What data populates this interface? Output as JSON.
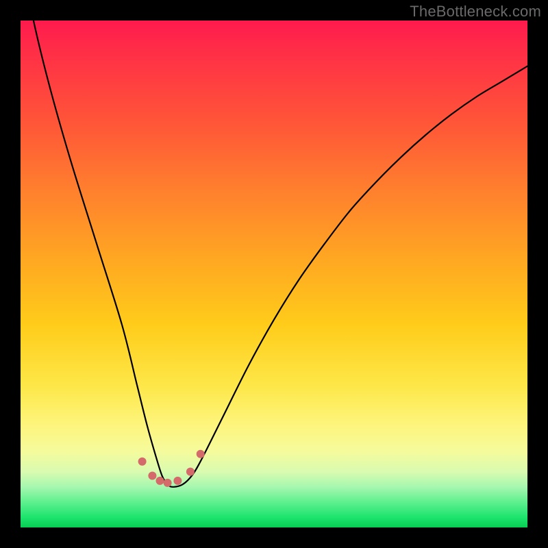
{
  "watermark": "TheBottleneck.com",
  "chart_data": {
    "type": "line",
    "title": "",
    "xlabel": "",
    "ylabel": "",
    "xlim": [
      0,
      100
    ],
    "ylim": [
      0,
      100
    ],
    "grid": false,
    "legend": false,
    "series": [
      {
        "name": "bottleneck-curve",
        "x": [
          0,
          1,
          3,
          6,
          10,
          15,
          20,
          23,
          25,
          27,
          28,
          29,
          30,
          32,
          34,
          36,
          40,
          45,
          50,
          55,
          60,
          65,
          70,
          75,
          80,
          85,
          90,
          95,
          100
        ],
        "values": [
          115,
          108,
          98,
          86,
          72,
          56,
          40,
          28,
          20,
          13,
          10,
          8.5,
          8,
          8.5,
          10.5,
          14,
          22,
          32,
          41,
          49,
          56,
          62.5,
          68,
          73,
          77.5,
          81.5,
          85,
          88,
          91
        ]
      }
    ],
    "optimal_points": {
      "name": "optimal-range-dots",
      "x": [
        24,
        26,
        27.5,
        29,
        31,
        33.5,
        35.5
      ],
      "values": [
        13,
        10.2,
        9.2,
        8.8,
        9.2,
        11,
        14.5
      ]
    },
    "background_gradient": {
      "top": "#ff1a4d",
      "upper": "#ff7e2e",
      "mid": "#ffcc1a",
      "lower": "#fdf57e",
      "bottom": "#07cd54"
    },
    "curve_color": "#000000",
    "dot_color": "#d46a6a",
    "frame_color": "#000000"
  }
}
